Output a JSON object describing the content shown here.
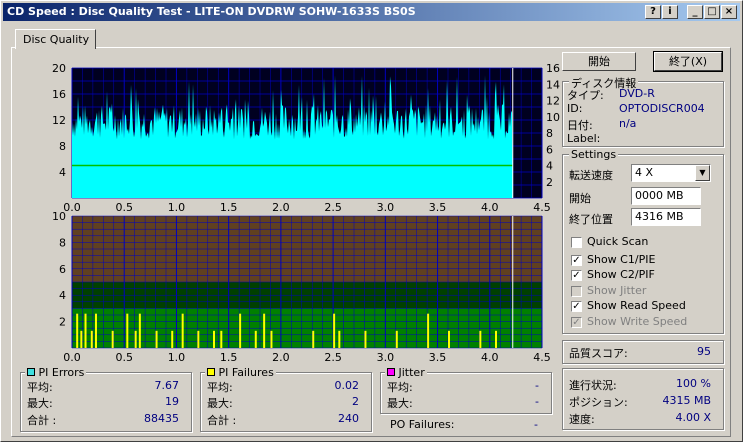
{
  "window": {
    "title": "CD Speed : Disc Quality Test - LITE-ON DVDRW SOHW-1633S BS0S"
  },
  "tabs": [
    {
      "label": "Disc Quality"
    }
  ],
  "buttons": {
    "start": "開始",
    "exit": "終了(X)"
  },
  "disc_info": {
    "title": "ディスク情報",
    "type_label": "タイプ:",
    "type_value": "DVD-R",
    "id_label": "ID:",
    "id_value": "OPTODISCR004",
    "date_label": "日付:",
    "date_value": "n/a",
    "label_label": "Label:"
  },
  "settings": {
    "title": "Settings",
    "speed_label": "転送速度",
    "speed_value": "4 X",
    "start_label": "開始",
    "start_value": "0000 MB",
    "end_label": "終了位置",
    "end_value": "4316 MB",
    "checks": [
      {
        "label": "Quick Scan",
        "checked": false,
        "enabled": true
      },
      {
        "label": "Show C1/PIE",
        "checked": true,
        "enabled": true
      },
      {
        "label": "Show C2/PIF",
        "checked": true,
        "enabled": true
      },
      {
        "label": "Show Jitter",
        "checked": false,
        "enabled": false
      },
      {
        "label": "Show Read Speed",
        "checked": true,
        "enabled": true
      },
      {
        "label": "Show Write Speed",
        "checked": true,
        "enabled": false
      }
    ]
  },
  "score": {
    "label": "品質スコア:",
    "value": "95"
  },
  "progress": {
    "progress_label": "進行状況:",
    "progress_value": "100 %",
    "position_label": "ポジション:",
    "position_value": "4315 MB",
    "speed_label": "速度:",
    "speed_value": "4.00 X"
  },
  "pi_errors": {
    "title": "PI Errors",
    "avg_label": "平均:",
    "avg": "7.67",
    "max_label": "最大:",
    "max": "19",
    "total_label": "合計 :",
    "total": "88435",
    "color": "#40e0e0"
  },
  "pi_failures": {
    "title": "PI Failures",
    "avg_label": "平均:",
    "avg": "0.02",
    "max_label": "最大:",
    "max": "2",
    "total_label": "合計 :",
    "total": "240",
    "color": "#ffff00"
  },
  "jitter": {
    "title": "Jitter",
    "avg_label": "平均:",
    "avg": "-",
    "max_label": "最大:",
    "max": "-",
    "color": "#ff00ff"
  },
  "po_failures": {
    "label": "PO Failures:",
    "value": "-"
  },
  "chart_data": [
    {
      "type": "area",
      "title": "",
      "x_ticks": [
        "0.0",
        "0.5",
        "1.0",
        "1.5",
        "2.0",
        "2.5",
        "3.0",
        "3.5",
        "4.0",
        "4.5"
      ],
      "xlim": [
        0,
        4.5
      ],
      "ylim": [
        0,
        20
      ],
      "y_ticks_left": [
        "20",
        "16",
        "12",
        "8",
        "4"
      ],
      "y_ticks_right": [
        "16",
        "14",
        "12",
        "10",
        "8",
        "6",
        "4",
        "2"
      ],
      "y2lim": [
        0,
        16
      ],
      "grid": true,
      "data_end_x": 4.22,
      "series": [
        {
          "values_range": [
            9,
            19
          ]
        },
        {
          "values": [
            4,
            4
          ]
        }
      ]
    },
    {
      "type": "bar",
      "title": "",
      "x_ticks": [
        "0.0",
        "0.5",
        "1.0",
        "1.5",
        "2.0",
        "2.5",
        "3.0",
        "3.5",
        "4.0",
        "4.5"
      ],
      "xlim": [
        0,
        4.5
      ],
      "ylim": [
        0,
        10
      ],
      "y_ticks": [
        "10",
        "8",
        "6",
        "4",
        "2"
      ],
      "grid": true,
      "data_end_x": 4.22,
      "bands": [
        {
          "from": 0,
          "to": 3,
          "color": "#008000"
        },
        {
          "from": 3,
          "to": 5,
          "color": "#004000"
        },
        {
          "from": 5,
          "to": 10,
          "color": "#604020"
        }
      ],
      "spikes": [
        {
          "x": 0.04,
          "y": 2
        },
        {
          "x": 0.08,
          "y": 1
        },
        {
          "x": 0.12,
          "y": 2
        },
        {
          "x": 0.18,
          "y": 1
        },
        {
          "x": 0.22,
          "y": 2
        },
        {
          "x": 0.38,
          "y": 1
        },
        {
          "x": 0.52,
          "y": 2
        },
        {
          "x": 0.6,
          "y": 1
        },
        {
          "x": 0.64,
          "y": 2
        },
        {
          "x": 0.8,
          "y": 1
        },
        {
          "x": 0.95,
          "y": 1
        },
        {
          "x": 1.05,
          "y": 2
        },
        {
          "x": 1.2,
          "y": 1
        },
        {
          "x": 1.35,
          "y": 1
        },
        {
          "x": 1.42,
          "y": 1
        },
        {
          "x": 1.6,
          "y": 2
        },
        {
          "x": 1.75,
          "y": 1
        },
        {
          "x": 1.83,
          "y": 2
        },
        {
          "x": 1.9,
          "y": 1
        },
        {
          "x": 2.3,
          "y": 1
        },
        {
          "x": 2.5,
          "y": 2
        },
        {
          "x": 2.55,
          "y": 1
        },
        {
          "x": 2.8,
          "y": 1
        },
        {
          "x": 3.1,
          "y": 1
        },
        {
          "x": 3.4,
          "y": 2
        },
        {
          "x": 3.6,
          "y": 1
        },
        {
          "x": 3.9,
          "y": 1
        },
        {
          "x": 4.05,
          "y": 1
        }
      ]
    }
  ],
  "colors": {
    "chart_bg": "#000020",
    "grid": "#0000c0",
    "pie": "#00ffff",
    "speed_line": "#00c000",
    "pif": "#ffff00"
  }
}
